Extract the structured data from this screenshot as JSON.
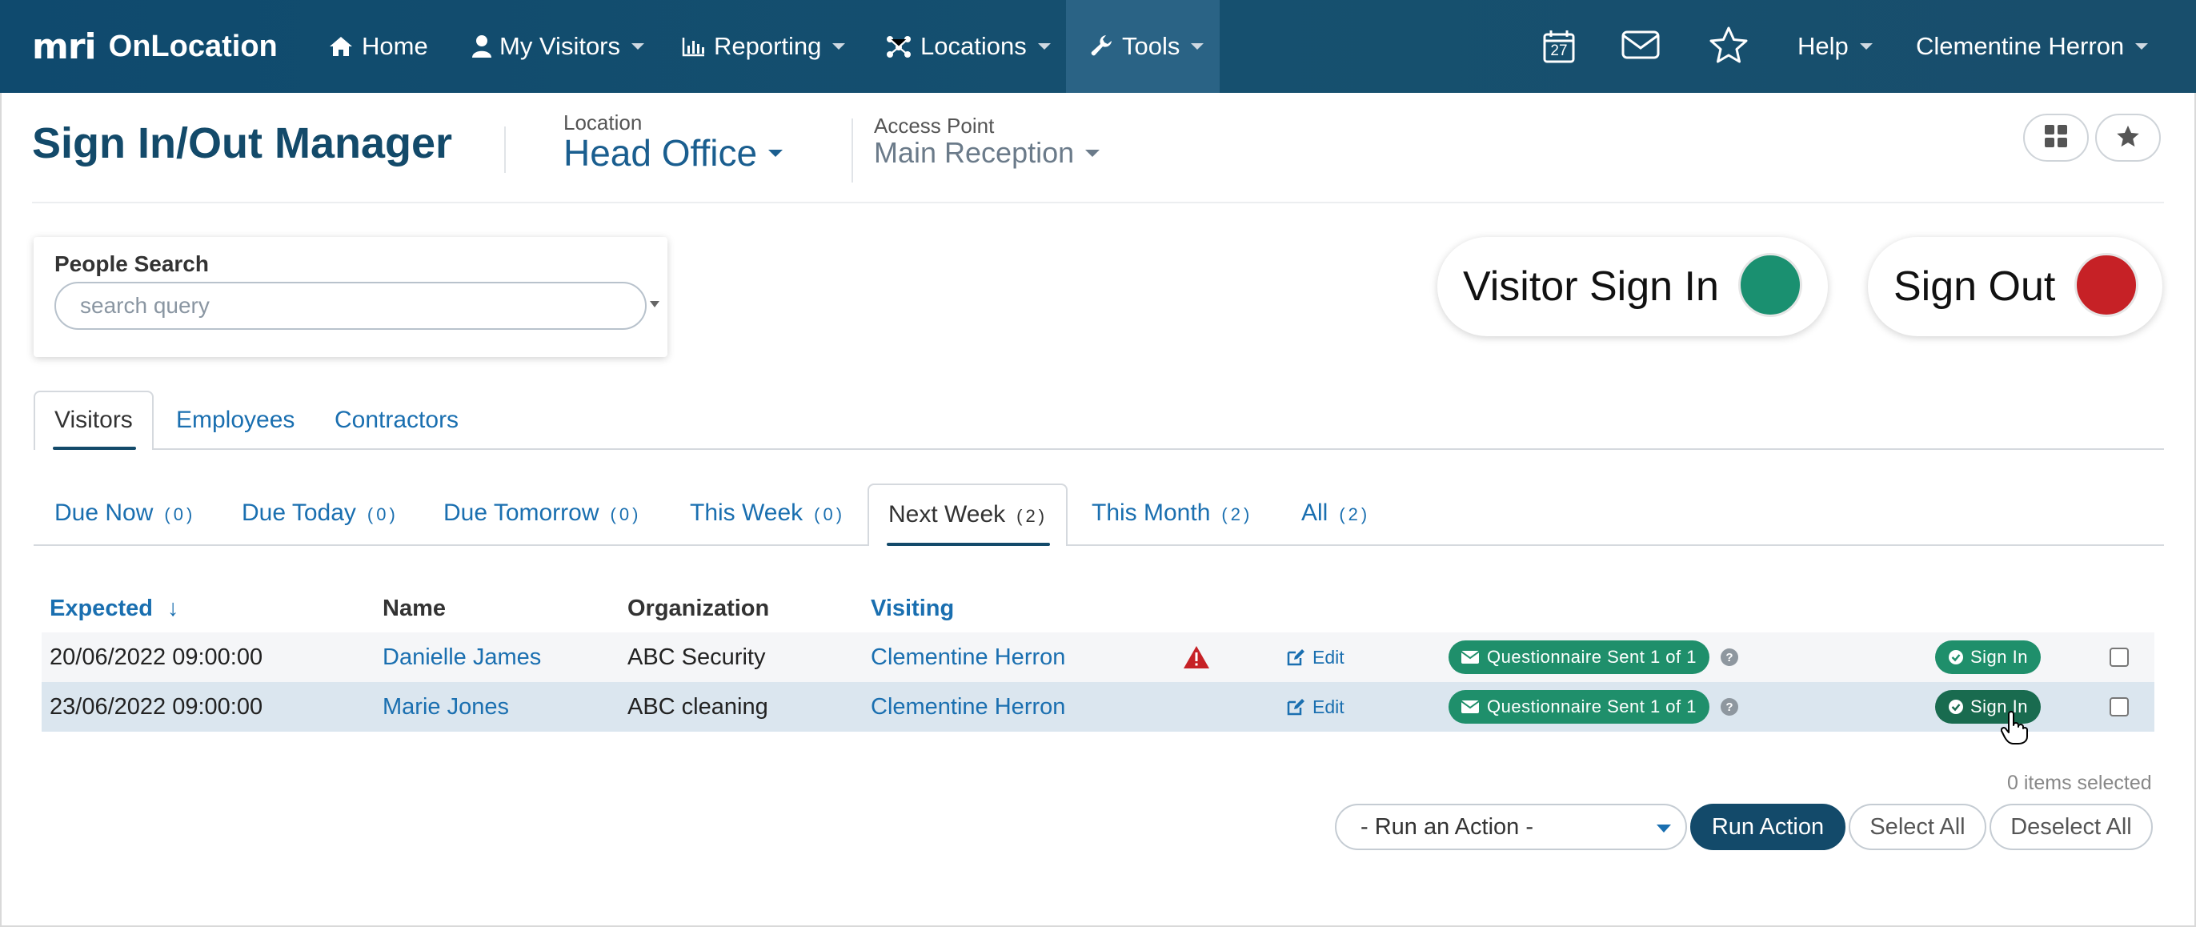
{
  "navbar": {
    "logo": "mri",
    "app_name": "OnLocation",
    "items": [
      {
        "label": "Home",
        "icon": "home-icon"
      },
      {
        "label": "My Visitors",
        "icon": "user-icon"
      },
      {
        "label": "Reporting",
        "icon": "bar-chart-icon"
      },
      {
        "label": "Locations",
        "icon": "network-icon"
      },
      {
        "label": "Tools",
        "icon": "wrench-icon"
      }
    ],
    "calendar_day": "27",
    "help_label": "Help",
    "user_name": "Clementine Herron"
  },
  "header": {
    "title": "Sign In/Out Manager",
    "location_label": "Location",
    "location_value": "Head Office",
    "access_point_label": "Access Point",
    "access_point_value": "Main Reception"
  },
  "search": {
    "label": "People Search",
    "placeholder": "search query"
  },
  "actions": {
    "visitor_sign_in": "Visitor Sign In",
    "sign_out": "Sign Out",
    "sign_in_color": "#1a9070",
    "sign_out_color": "#c62126"
  },
  "people_tabs": [
    "Visitors",
    "Employees",
    "Contractors"
  ],
  "filter_tabs": [
    {
      "label": "Due Now",
      "count": "(0)"
    },
    {
      "label": "Due Today",
      "count": "(0)"
    },
    {
      "label": "Due Tomorrow",
      "count": "(0)"
    },
    {
      "label": "This Week",
      "count": "(0)"
    },
    {
      "label": "Next Week",
      "count": "(2)"
    },
    {
      "label": "This Month",
      "count": "(2)"
    },
    {
      "label": "All",
      "count": "(2)"
    }
  ],
  "table": {
    "columns": {
      "expected": "Expected",
      "sort_arrow": "↓",
      "name": "Name",
      "organization": "Organization",
      "visiting": "Visiting"
    },
    "rows": [
      {
        "expected": "20/06/2022 09:00:00",
        "name": "Danielle James",
        "organization": "ABC Security",
        "visiting": "Clementine Herron",
        "warning": true,
        "edit": "Edit",
        "questionnaire": "Questionnaire Sent 1 of 1",
        "sign_in": "Sign In"
      },
      {
        "expected": "23/06/2022 09:00:00",
        "name": "Marie Jones",
        "organization": "ABC cleaning",
        "visiting": "Clementine Herron",
        "warning": false,
        "edit": "Edit",
        "questionnaire": "Questionnaire Sent 1 of 1",
        "sign_in": "Sign In"
      }
    ]
  },
  "footer": {
    "items_selected": "0 items selected",
    "action_select": "- Run an Action -",
    "run_action": "Run Action",
    "select_all": "Select All",
    "deselect_all": "Deselect All"
  }
}
